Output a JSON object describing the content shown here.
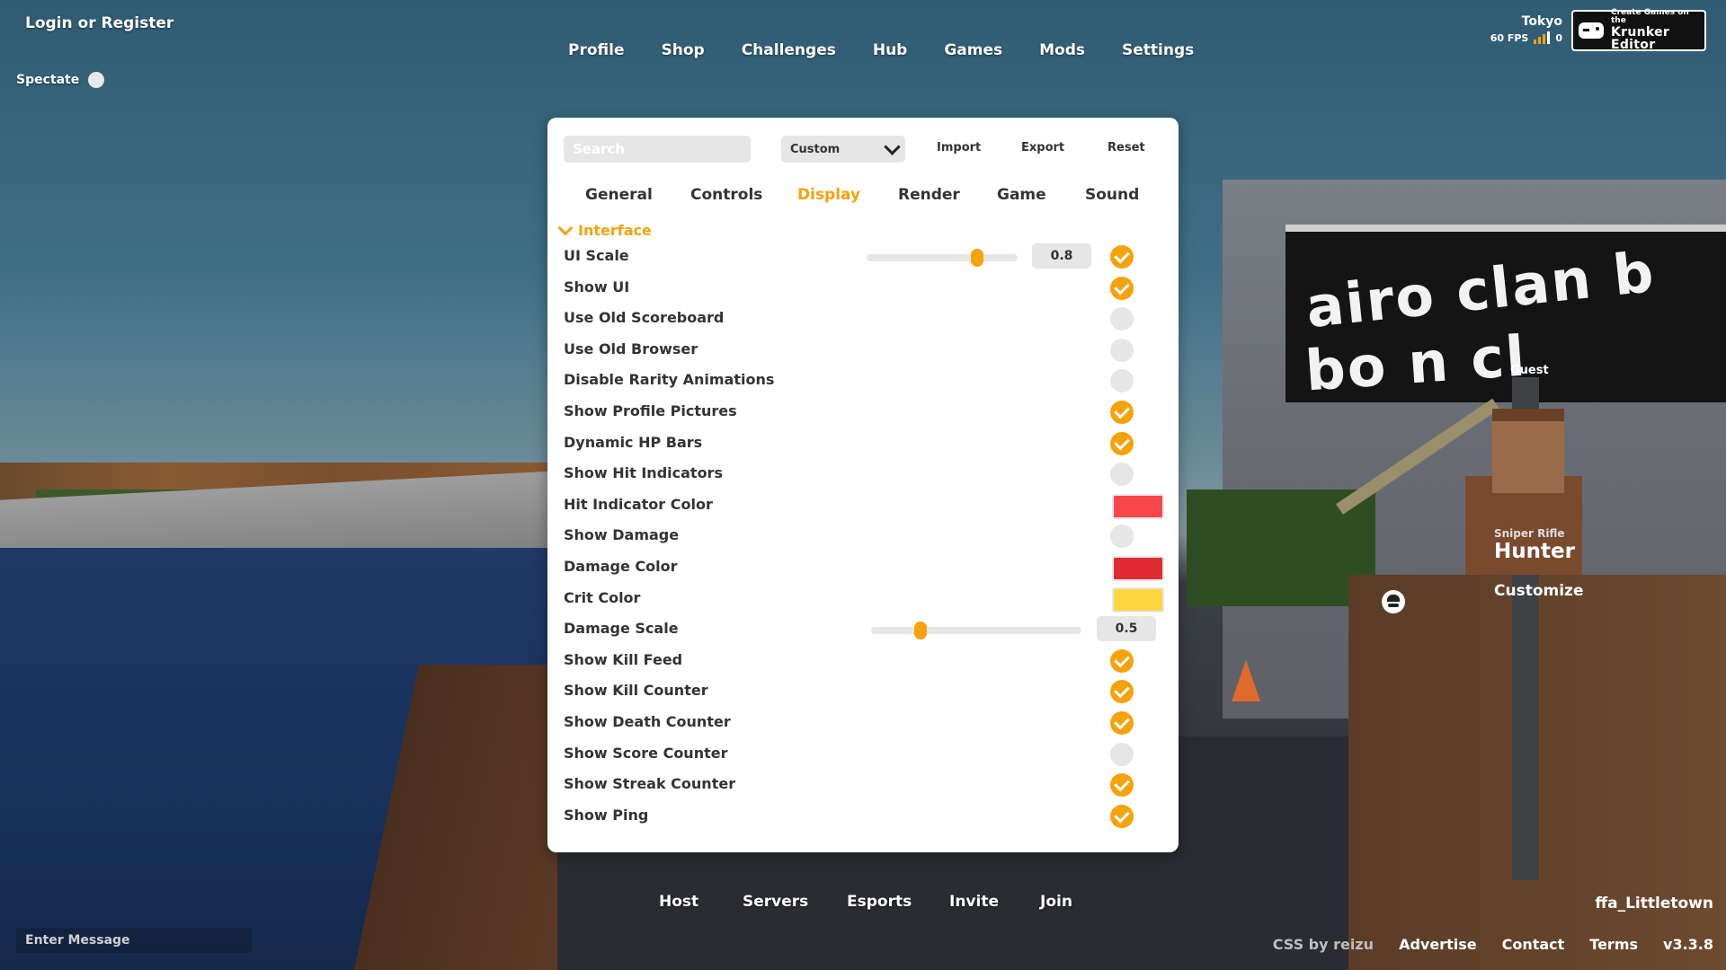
{
  "top": {
    "login": "Login or Register",
    "spectate": "Spectate",
    "nav": [
      "Profile",
      "Shop",
      "Challenges",
      "Hub",
      "Games",
      "Mods",
      "Settings"
    ],
    "region": "Tokyo",
    "fps": "60 FPS",
    "ping": "0",
    "editor_line1": "Create Games on the",
    "editor_line2": "Krunker Editor"
  },
  "settings": {
    "search_placeholder": "Search",
    "preset": "Custom",
    "import": "Import",
    "export": "Export",
    "reset": "Reset",
    "tabs": [
      "General",
      "Controls",
      "Display",
      "Render",
      "Game",
      "Sound"
    ],
    "active_tab": "Display",
    "section": "Interface",
    "rows": [
      {
        "label": "UI Scale",
        "type": "slider",
        "value": "0.8",
        "level": 0.75,
        "checked": true
      },
      {
        "label": "Show UI",
        "type": "check",
        "checked": true
      },
      {
        "label": "Use Old Scoreboard",
        "type": "check",
        "checked": false
      },
      {
        "label": "Use Old Browser",
        "type": "check",
        "checked": false
      },
      {
        "label": "Disable Rarity Animations",
        "type": "check",
        "checked": false
      },
      {
        "label": "Show Profile Pictures",
        "type": "check",
        "checked": true
      },
      {
        "label": "Dynamic HP Bars",
        "type": "check",
        "checked": true
      },
      {
        "label": "Show Hit Indicators",
        "type": "check",
        "checked": false
      },
      {
        "label": "Hit Indicator Color",
        "type": "color",
        "color": "#f7474b"
      },
      {
        "label": "Show Damage",
        "type": "check",
        "checked": false
      },
      {
        "label": "Damage Color",
        "type": "color",
        "color": "#e02a33"
      },
      {
        "label": "Crit Color",
        "type": "color",
        "color": "#fcd53f"
      },
      {
        "label": "Damage Scale",
        "type": "slider",
        "value": "0.5",
        "level": 0.22
      },
      {
        "label": "Show Kill Feed",
        "type": "check",
        "checked": true
      },
      {
        "label": "Show Kill Counter",
        "type": "check",
        "checked": true
      },
      {
        "label": "Show Death Counter",
        "type": "check",
        "checked": true
      },
      {
        "label": "Show Score Counter",
        "type": "check",
        "checked": false
      },
      {
        "label": "Show Streak Counter",
        "type": "check",
        "checked": true
      },
      {
        "label": "Show Ping",
        "type": "check",
        "checked": true
      }
    ]
  },
  "player": {
    "name": "Guest",
    "weapon": "Sniper Rifle",
    "class": "Hunter",
    "customize": "Customize"
  },
  "billboard": {
    "line1": "airo clan b",
    "line2": "bo     n cl"
  },
  "bottom": {
    "nav": [
      "Host",
      "Servers",
      "Esports",
      "Invite",
      "Join"
    ],
    "chat_placeholder": "Enter Message",
    "map": "ffa_Littletown",
    "credit": "CSS by reizu",
    "links": [
      "Advertise",
      "Contact",
      "Terms"
    ],
    "version": "v3.3.8"
  },
  "colors": {
    "accent": "#f5a20b",
    "panel": "#ffffff",
    "toggle_off": "#e6e6e6"
  }
}
